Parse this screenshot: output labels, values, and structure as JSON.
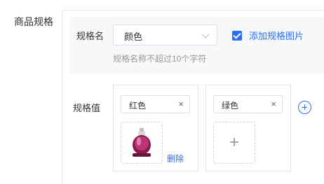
{
  "form": {
    "section_label": "商品规格",
    "name_label": "规格名",
    "name_value": "颜色",
    "name_hint": "规格名称不超过10个字符",
    "add_image_label": "添加规格图片",
    "add_image_checked": true,
    "value_label": "规格值",
    "values": [
      {
        "text": "红色",
        "has_image": true,
        "delete_label": "删除"
      },
      {
        "text": "绿色",
        "has_image": false
      }
    ],
    "close_glyph": "×",
    "plus_glyph": "+"
  },
  "colors": {
    "accent": "#2d6cf6",
    "panel_bg": "#f7f8fa"
  }
}
